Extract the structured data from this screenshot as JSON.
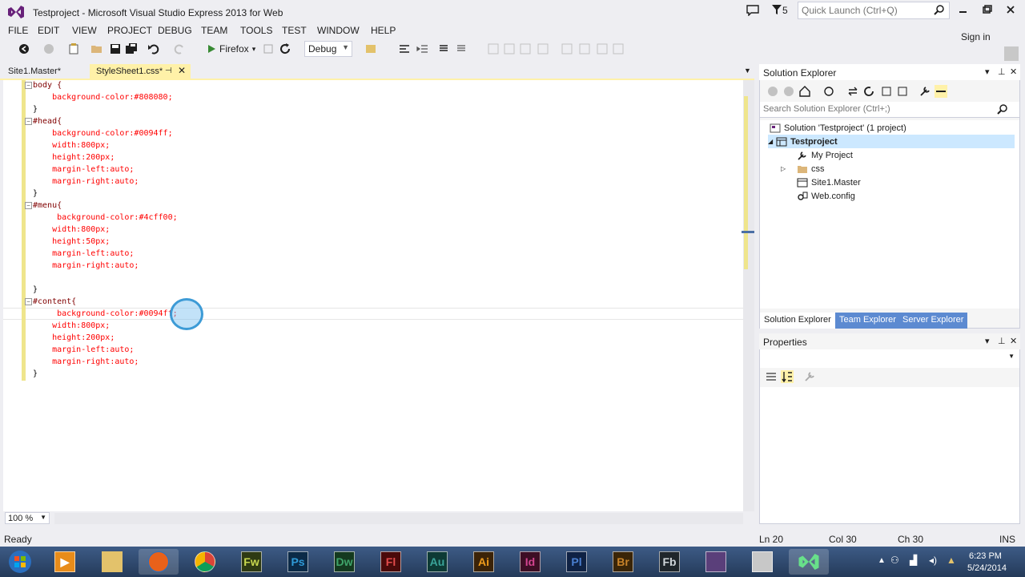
{
  "app": {
    "title": "Testproject - Microsoft Visual Studio Express 2013 for Web",
    "filter_count": "5",
    "quick_launch_placeholder": "Quick Launch (Ctrl+Q)",
    "sign_in": "Sign in"
  },
  "menu": [
    "FILE",
    "EDIT",
    "VIEW",
    "PROJECT",
    "DEBUG",
    "TEAM",
    "TOOLS",
    "TEST",
    "WINDOW",
    "HELP"
  ],
  "toolbar": {
    "run_target": "Firefox",
    "configuration": "Debug"
  },
  "tabs": [
    {
      "label": "Site1.Master*",
      "active": false
    },
    {
      "label": "StyleSheet1.css*",
      "active": true
    }
  ],
  "editor": {
    "zoom": "100 %",
    "lines": [
      "body {",
      "    background-color:#808080;",
      "}",
      "#head{",
      "    background-color:#0094ff;",
      "    width:800px;",
      "    height:200px;",
      "    margin-left:auto;",
      "    margin-right:auto;",
      "}",
      "#menu{",
      "     background-color:#4cff00;",
      "    width:800px;",
      "    height:50px;",
      "    margin-left:auto;",
      "    margin-right:auto;",
      "",
      "}",
      "#content{",
      "     background-color:#0094ff;",
      "    width:800px;",
      "    height:200px;",
      "    margin-left:auto;",
      "    margin-right:auto;",
      "}"
    ]
  },
  "solution_explorer": {
    "title": "Solution Explorer",
    "search_placeholder": "Search Solution Explorer (Ctrl+;)",
    "tree": [
      {
        "label": "Solution 'Testproject' (1 project)",
        "icon": "solution-icon"
      },
      {
        "label": "Testproject",
        "icon": "web-project-icon",
        "selected": true
      },
      {
        "label": "My Project",
        "icon": "wrench-icon"
      },
      {
        "label": "css",
        "icon": "folder-icon"
      },
      {
        "label": "Site1.Master",
        "icon": "master-page-icon"
      },
      {
        "label": "Web.config",
        "icon": "config-file-icon"
      }
    ],
    "tabs": [
      "Solution Explorer",
      "Team Explorer",
      "Server Explorer"
    ]
  },
  "properties": {
    "title": "Properties"
  },
  "status": {
    "left": "Ready",
    "line": "Ln 20",
    "col": "Col 30",
    "ch": "Ch 30",
    "mode": "INS"
  },
  "taskbar": {
    "apps": [
      {
        "name": "windows-start-icon",
        "label": ""
      },
      {
        "name": "media-player-icon",
        "label": ""
      },
      {
        "name": "file-explorer-icon",
        "label": ""
      },
      {
        "name": "firefox-icon",
        "label": ""
      },
      {
        "name": "chrome-icon",
        "label": ""
      },
      {
        "name": "fireworks-icon",
        "label": "Fw",
        "color": "#c8d84f"
      },
      {
        "name": "photoshop-icon",
        "label": "Ps",
        "color": "#2f9ad7"
      },
      {
        "name": "dreamweaver-icon",
        "label": "Dw",
        "color": "#3fa46a"
      },
      {
        "name": "flash-icon",
        "label": "Fl",
        "color": "#c83030"
      },
      {
        "name": "audition-icon",
        "label": "Au",
        "color": "#3aa399"
      },
      {
        "name": "illustrator-icon",
        "label": "Ai",
        "color": "#ef9c1c"
      },
      {
        "name": "indesign-icon",
        "label": "Id",
        "color": "#d34490"
      },
      {
        "name": "prelude-icon",
        "label": "Pl",
        "color": "#4a7fd0"
      },
      {
        "name": "bridge-icon",
        "label": "Br",
        "color": "#c8832a"
      },
      {
        "name": "flash-builder-icon",
        "label": "Fb",
        "color": "#5a6770"
      },
      {
        "name": "vs-express-icon",
        "label": ""
      },
      {
        "name": "remote-desktop-icon",
        "label": ""
      },
      {
        "name": "visual-studio-icon",
        "label": ""
      }
    ],
    "time": "6:23 PM",
    "date": "5/24/2014"
  }
}
